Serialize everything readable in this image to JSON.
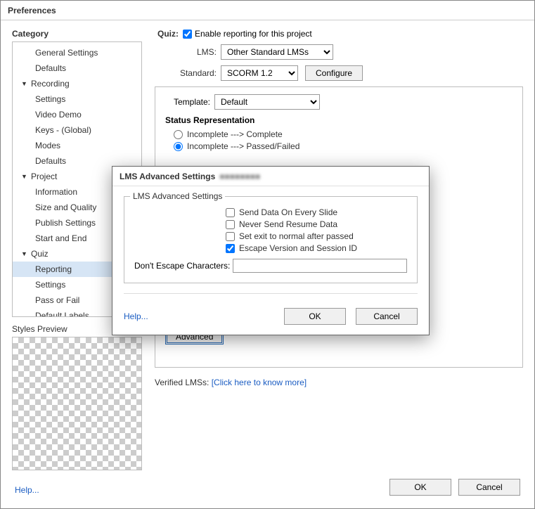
{
  "window": {
    "title": "Preferences"
  },
  "category": {
    "title": "Category",
    "items": [
      {
        "type": "item",
        "label": "General Settings"
      },
      {
        "type": "item",
        "label": "Defaults"
      },
      {
        "type": "group",
        "label": "Recording",
        "expanded": true
      },
      {
        "type": "item",
        "label": "Settings"
      },
      {
        "type": "item",
        "label": "Video Demo"
      },
      {
        "type": "item",
        "label": "Keys - (Global)"
      },
      {
        "type": "item",
        "label": "Modes"
      },
      {
        "type": "item",
        "label": "Defaults"
      },
      {
        "type": "group",
        "label": "Project",
        "expanded": true
      },
      {
        "type": "item",
        "label": "Information"
      },
      {
        "type": "item",
        "label": "Size and Quality"
      },
      {
        "type": "item",
        "label": "Publish Settings"
      },
      {
        "type": "item",
        "label": "Start and End"
      },
      {
        "type": "group",
        "label": "Quiz",
        "expanded": true
      },
      {
        "type": "item",
        "label": "Reporting",
        "selected": true
      },
      {
        "type": "item",
        "label": "Settings"
      },
      {
        "type": "item",
        "label": "Pass or Fail"
      },
      {
        "type": "item",
        "label": "Default Labels"
      }
    ]
  },
  "styles": {
    "label": "Styles Preview"
  },
  "quiz": {
    "header": "Quiz:",
    "enable_label": "Enable reporting for this project",
    "lms_label": "LMS:",
    "lms_value": "Other Standard LMSs",
    "standard_label": "Standard:",
    "standard_value": "SCORM 1.2",
    "configure_label": "Configure",
    "template_label": "Template:",
    "template_value": "Default",
    "status_title": "Status Representation",
    "status_option1": "Incomplete ---> Complete",
    "status_option2": "Incomplete ---> Passed/Failed",
    "advanced_label": "Advanced",
    "verified_label": "Verified LMSs:",
    "verified_link": "[Click here to know more]"
  },
  "modal": {
    "title": "LMS Advanced Settings",
    "legend": "LMS Advanced Settings",
    "chk1": "Send Data On Every Slide",
    "chk2": "Never Send Resume Data",
    "chk3": "Set exit to normal after passed",
    "chk4": "Escape Version and Session ID",
    "escape_label": "Don't Escape Characters:",
    "help": "Help...",
    "ok": "OK",
    "cancel": "Cancel"
  },
  "footer": {
    "help": "Help...",
    "ok": "OK",
    "cancel": "Cancel"
  }
}
